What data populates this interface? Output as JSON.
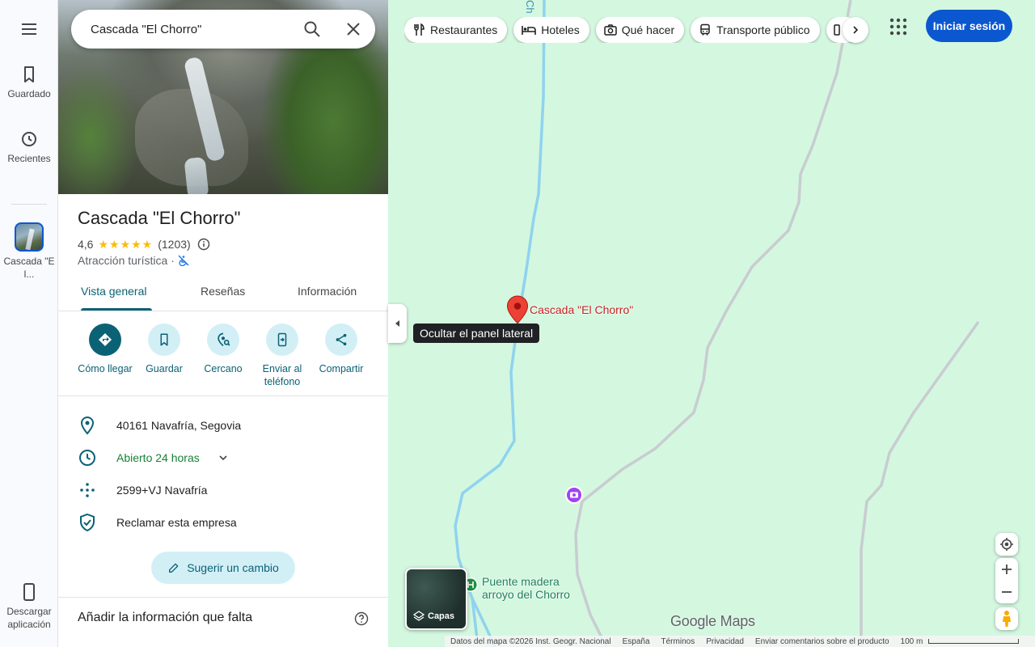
{
  "rail": {
    "saved_label": "Guardado",
    "recent_label": "Recientes",
    "recent_item_label": "Cascada \"El...",
    "download_label": "Descargar aplicación"
  },
  "search": {
    "value": "Cascada \"El Chorro\""
  },
  "place": {
    "name": "Cascada \"El Chorro\"",
    "rating": "4,6",
    "stars": "★★★★★",
    "review_count": "(1203)",
    "category": "Atracción turística",
    "separator": "·"
  },
  "tabs": [
    {
      "label": "Vista general",
      "active": true
    },
    {
      "label": "Reseñas",
      "active": false
    },
    {
      "label": "Información",
      "active": false
    }
  ],
  "actions": [
    {
      "label": "Cómo llegar",
      "icon": "directions-icon"
    },
    {
      "label": "Guardar",
      "icon": "bookmark-icon"
    },
    {
      "label": "Cercano",
      "icon": "nearby-icon"
    },
    {
      "label": "Enviar al teléfono",
      "icon": "send-to-phone-icon"
    },
    {
      "label": "Compartir",
      "icon": "share-icon"
    }
  ],
  "details": {
    "address": "40161 Navafría, Segovia",
    "hours": "Abierto 24 horas",
    "plus_code": "2599+VJ Navafría",
    "claim": "Reclamar esta empresa"
  },
  "suggest_label": "Sugerir un cambio",
  "missing_info_label": "Añadir la información que falta",
  "collapse_tooltip": "Ocultar el panel lateral",
  "chips": [
    {
      "label": "Restaurantes",
      "icon": "restaurant-icon"
    },
    {
      "label": "Hoteles",
      "icon": "hotel-icon"
    },
    {
      "label": "Qué hacer",
      "icon": "camera-icon"
    },
    {
      "label": "Transporte público",
      "icon": "transit-icon"
    }
  ],
  "signin_label": "Iniciar sesión",
  "map": {
    "pin_label": "Cascada \"El Chorro\"",
    "poi_label_line1": "Puente madera",
    "poi_label_line2": "arroyo del Chorro",
    "river_label": "Ch",
    "layers_label": "Capas",
    "logo": "Google Maps"
  },
  "footer": {
    "data": "Datos del mapa ©2026 Inst. Geogr. Nacional",
    "country": "España",
    "terms": "Términos",
    "privacy": "Privacidad",
    "feedback": "Enviar comentarios sobre el producto",
    "scale": "100 m"
  },
  "colors": {
    "accent": "#0b6275",
    "primary_blue": "#0b57d0",
    "map_bg": "#d4f7e0",
    "river": "#8fd3ee",
    "road": "#c8ccd0",
    "pin": "#ea4335",
    "open_green": "#188038"
  }
}
